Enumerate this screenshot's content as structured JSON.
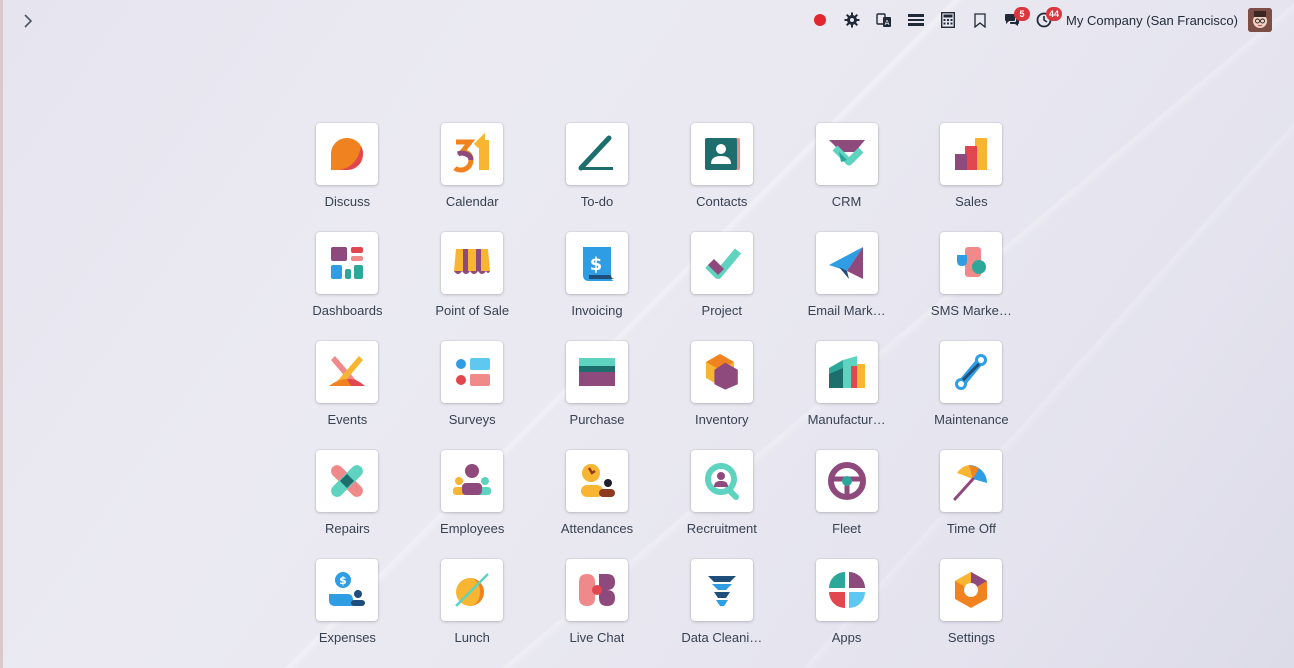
{
  "navbar": {
    "toggle_icon": "chevron-right-icon",
    "company_name": "My Company (San Francisco)",
    "messages_count": "5",
    "activities_count": "44"
  },
  "apps": [
    {
      "label": "Discuss",
      "icon": "discuss-icon"
    },
    {
      "label": "Calendar",
      "icon": "calendar-icon"
    },
    {
      "label": "To-do",
      "icon": "todo-icon"
    },
    {
      "label": "Contacts",
      "icon": "contacts-icon"
    },
    {
      "label": "CRM",
      "icon": "crm-icon"
    },
    {
      "label": "Sales",
      "icon": "sales-icon"
    },
    {
      "label": "Dashboards",
      "icon": "dashboards-icon"
    },
    {
      "label": "Point of Sale",
      "icon": "point-of-sale-icon"
    },
    {
      "label": "Invoicing",
      "icon": "invoicing-icon"
    },
    {
      "label": "Project",
      "icon": "project-icon"
    },
    {
      "label": "Email Mark…",
      "icon": "email-marketing-icon"
    },
    {
      "label": "SMS Marke…",
      "icon": "sms-marketing-icon"
    },
    {
      "label": "Events",
      "icon": "events-icon"
    },
    {
      "label": "Surveys",
      "icon": "surveys-icon"
    },
    {
      "label": "Purchase",
      "icon": "purchase-icon"
    },
    {
      "label": "Inventory",
      "icon": "inventory-icon"
    },
    {
      "label": "Manufactur…",
      "icon": "manufacturing-icon"
    },
    {
      "label": "Maintenance",
      "icon": "maintenance-icon"
    },
    {
      "label": "Repairs",
      "icon": "repairs-icon"
    },
    {
      "label": "Employees",
      "icon": "employees-icon"
    },
    {
      "label": "Attendances",
      "icon": "attendances-icon"
    },
    {
      "label": "Recruitment",
      "icon": "recruitment-icon"
    },
    {
      "label": "Fleet",
      "icon": "fleet-icon"
    },
    {
      "label": "Time Off",
      "icon": "time-off-icon"
    },
    {
      "label": "Expenses",
      "icon": "expenses-icon"
    },
    {
      "label": "Lunch",
      "icon": "lunch-icon"
    },
    {
      "label": "Live Chat",
      "icon": "live-chat-icon"
    },
    {
      "label": "Data Cleani…",
      "icon": "data-cleaning-icon"
    },
    {
      "label": "Apps",
      "icon": "apps-icon"
    },
    {
      "label": "Settings",
      "icon": "settings-icon"
    }
  ],
  "colors": {
    "orange": "#f0831f",
    "purple": "#8e4a7d",
    "teal": "#2ba89a",
    "mint": "#5ed3c0",
    "pink": "#f08a8a",
    "red": "#e2474f",
    "yellow": "#f7b531",
    "blue": "#2f9de4",
    "dark_teal": "#1f6e6e",
    "badge": "#d9363e"
  }
}
